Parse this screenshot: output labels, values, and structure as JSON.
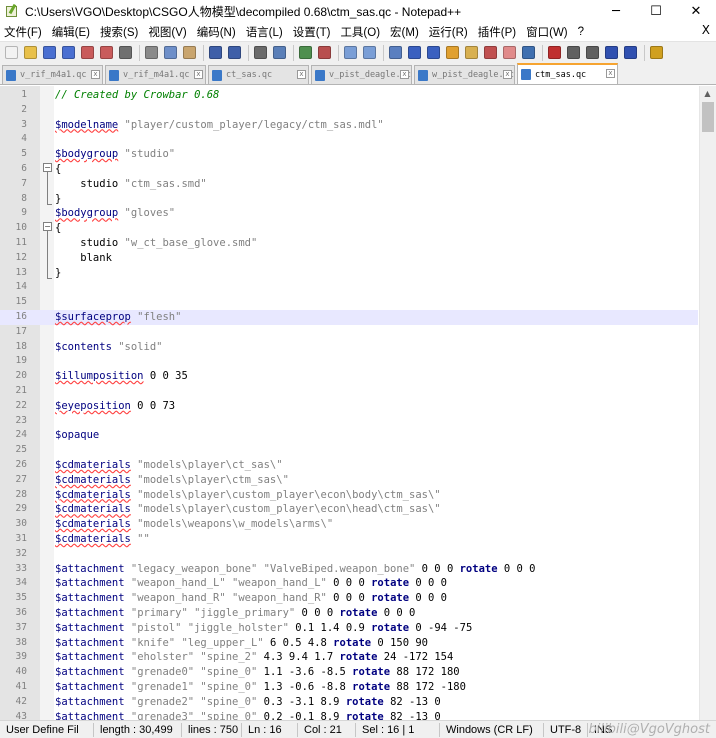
{
  "window": {
    "title": "C:\\Users\\VGO\\Desktop\\CSGO人物模型\\decompiled 0.68\\ctm_sas.qc - Notepad++",
    "minimize": "─",
    "maximize": "☐",
    "close": "✕"
  },
  "menu": {
    "items": [
      "文件(F)",
      "编辑(E)",
      "搜索(S)",
      "视图(V)",
      "编码(N)",
      "语言(L)",
      "设置(T)",
      "工具(O)",
      "宏(M)",
      "运行(R)",
      "插件(P)",
      "窗口(W)",
      "?"
    ],
    "close": "X"
  },
  "toolbar": {
    "icons": [
      {
        "name": "new-file-icon",
        "color": "#f2f2f2"
      },
      {
        "name": "open-file-icon",
        "color": "#e8c04a"
      },
      {
        "name": "save-icon",
        "color": "#4a6fd1"
      },
      {
        "name": "save-all-icon",
        "color": "#4a6fd1"
      },
      {
        "name": "close-file-icon",
        "color": "#c95b5b"
      },
      {
        "name": "close-all-icon",
        "color": "#c95b5b"
      },
      {
        "name": "print-icon",
        "color": "#707070"
      },
      {
        "sep": true
      },
      {
        "name": "cut-icon",
        "color": "#8a8a8a"
      },
      {
        "name": "copy-icon",
        "color": "#6e8fc9"
      },
      {
        "name": "paste-icon",
        "color": "#c9a56e"
      },
      {
        "sep": true
      },
      {
        "name": "undo-icon",
        "color": "#3f5fa8"
      },
      {
        "name": "redo-icon",
        "color": "#3f5fa8"
      },
      {
        "sep": true
      },
      {
        "name": "find-icon",
        "color": "#6a6a6a"
      },
      {
        "name": "replace-icon",
        "color": "#5a7fb8"
      },
      {
        "sep": true
      },
      {
        "name": "zoom-in-icon",
        "color": "#4f8f4f"
      },
      {
        "name": "zoom-out-icon",
        "color": "#b84f4f"
      },
      {
        "sep": true
      },
      {
        "name": "sync-v-icon",
        "color": "#7a9ed6"
      },
      {
        "name": "sync-h-icon",
        "color": "#7a9ed6"
      },
      {
        "sep": true
      },
      {
        "name": "word-wrap-icon",
        "color": "#5a7fc0"
      },
      {
        "name": "show-all-chars-icon",
        "color": "#3a60c0"
      },
      {
        "name": "indent-guide-icon",
        "color": "#3a60c0"
      },
      {
        "name": "lang-define-icon",
        "color": "#e0a030"
      },
      {
        "name": "doc-map-icon",
        "color": "#d8b050"
      },
      {
        "name": "function-list-icon",
        "color": "#c05050"
      },
      {
        "name": "folder-as-workspace-icon",
        "color": "#e08a8a"
      },
      {
        "name": "monitor-icon",
        "color": "#4070b0"
      },
      {
        "sep": true
      },
      {
        "name": "record-macro-icon",
        "color": "#c03030"
      },
      {
        "name": "stop-macro-icon",
        "color": "#606060"
      },
      {
        "name": "play-macro-icon",
        "color": "#606060"
      },
      {
        "name": "run-macro-multiple-icon",
        "color": "#3050b0"
      },
      {
        "name": "save-macro-icon",
        "color": "#3050b0"
      },
      {
        "sep": true
      },
      {
        "name": "spellcheck-icon",
        "color": "#d0a020"
      }
    ]
  },
  "tabs": [
    {
      "label": "v_rif_m4a1.qc",
      "active": false
    },
    {
      "label": "v_rif_m4a1.qc",
      "active": false
    },
    {
      "label": "ct_sas.qc",
      "active": false
    },
    {
      "label": "v_pist_deagle.qc",
      "active": false
    },
    {
      "label": "w_pist_deagle.qc",
      "active": false
    },
    {
      "label": "ctm_sas.qc",
      "active": true
    }
  ],
  "tab_close": "x",
  "editor": {
    "current_line": 16,
    "lines": [
      {
        "n": "1",
        "tokens": [
          {
            "t": "// Created by Crowbar 0.68",
            "c": "comment"
          }
        ]
      },
      {
        "n": "2",
        "tokens": []
      },
      {
        "n": "3",
        "tokens": [
          {
            "t": "$modelname",
            "c": "cmd-u"
          },
          {
            "t": " \"player/custom_player/legacy/ctm_sas.mdl\"",
            "c": "str"
          }
        ]
      },
      {
        "n": "4",
        "tokens": []
      },
      {
        "n": "5",
        "tokens": [
          {
            "t": "$bodygroup",
            "c": "cmd-u"
          },
          {
            "t": " \"studio\"",
            "c": "str"
          }
        ]
      },
      {
        "n": "6",
        "tokens": [
          {
            "t": "{",
            "c": "brace"
          }
        ]
      },
      {
        "n": "7",
        "tokens": [
          {
            "t": "    studio ",
            "c": "plain"
          },
          {
            "t": "\"ctm_sas.smd\"",
            "c": "str"
          }
        ]
      },
      {
        "n": "8",
        "tokens": [
          {
            "t": "}",
            "c": "brace"
          }
        ]
      },
      {
        "n": "9",
        "tokens": [
          {
            "t": "$bodygroup",
            "c": "cmd-u"
          },
          {
            "t": " \"gloves\"",
            "c": "str"
          }
        ]
      },
      {
        "n": "10",
        "tokens": [
          {
            "t": "{",
            "c": "brace"
          }
        ]
      },
      {
        "n": "11",
        "tokens": [
          {
            "t": "    studio ",
            "c": "plain"
          },
          {
            "t": "\"w_ct_base_glove.smd\"",
            "c": "str"
          }
        ]
      },
      {
        "n": "12",
        "tokens": [
          {
            "t": "    blank",
            "c": "plain"
          }
        ]
      },
      {
        "n": "13",
        "tokens": [
          {
            "t": "}",
            "c": "brace"
          }
        ]
      },
      {
        "n": "14",
        "tokens": []
      },
      {
        "n": "15",
        "tokens": []
      },
      {
        "n": "16",
        "tokens": [
          {
            "t": "$surfaceprop",
            "c": "cmd-u"
          },
          {
            "t": " \"flesh\"",
            "c": "str"
          }
        ]
      },
      {
        "n": "17",
        "tokens": []
      },
      {
        "n": "18",
        "tokens": [
          {
            "t": "$contents",
            "c": "cmd"
          },
          {
            "t": " \"solid\"",
            "c": "str"
          }
        ]
      },
      {
        "n": "19",
        "tokens": []
      },
      {
        "n": "20",
        "tokens": [
          {
            "t": "$illumposition",
            "c": "cmd-u"
          },
          {
            "t": " 0 0 35",
            "c": "num"
          }
        ]
      },
      {
        "n": "21",
        "tokens": []
      },
      {
        "n": "22",
        "tokens": [
          {
            "t": "$eyeposition",
            "c": "cmd-u"
          },
          {
            "t": " 0 0 73",
            "c": "num"
          }
        ]
      },
      {
        "n": "23",
        "tokens": []
      },
      {
        "n": "24",
        "tokens": [
          {
            "t": "$opaque",
            "c": "cmd"
          }
        ]
      },
      {
        "n": "25",
        "tokens": []
      },
      {
        "n": "26",
        "tokens": [
          {
            "t": "$cdmaterials",
            "c": "cmd-u"
          },
          {
            "t": " \"models\\player\\ct_sas\\\"",
            "c": "str"
          }
        ]
      },
      {
        "n": "27",
        "tokens": [
          {
            "t": "$cdmaterials",
            "c": "cmd-u"
          },
          {
            "t": " \"models\\player\\ctm_sas\\\"",
            "c": "str"
          }
        ]
      },
      {
        "n": "28",
        "tokens": [
          {
            "t": "$cdmaterials",
            "c": "cmd-u"
          },
          {
            "t": " \"models\\player\\custom_player\\econ\\body\\ctm_sas\\\"",
            "c": "str"
          }
        ]
      },
      {
        "n": "29",
        "tokens": [
          {
            "t": "$cdmaterials",
            "c": "cmd-u"
          },
          {
            "t": " \"models\\player\\custom_player\\econ\\head\\ctm_sas\\\"",
            "c": "str"
          }
        ]
      },
      {
        "n": "30",
        "tokens": [
          {
            "t": "$cdmaterials",
            "c": "cmd-u"
          },
          {
            "t": " \"models\\weapons\\w_models\\arms\\\"",
            "c": "str"
          }
        ]
      },
      {
        "n": "31",
        "tokens": [
          {
            "t": "$cdmaterials",
            "c": "cmd-u"
          },
          {
            "t": " \"\"",
            "c": "str"
          }
        ]
      },
      {
        "n": "32",
        "tokens": []
      },
      {
        "n": "33",
        "tokens": [
          {
            "t": "$attachment",
            "c": "cmd"
          },
          {
            "t": " \"legacy_weapon_bone\" \"ValveBiped.weapon_bone\"",
            "c": "str"
          },
          {
            "t": " 0 0 0 ",
            "c": "num"
          },
          {
            "t": "rotate",
            "c": "kw"
          },
          {
            "t": " 0 0 0",
            "c": "num"
          }
        ]
      },
      {
        "n": "34",
        "tokens": [
          {
            "t": "$attachment",
            "c": "cmd"
          },
          {
            "t": " \"weapon_hand_L\" \"weapon_hand_L\"",
            "c": "str"
          },
          {
            "t": " 0 0 0 ",
            "c": "num"
          },
          {
            "t": "rotate",
            "c": "kw"
          },
          {
            "t": " 0 0 0",
            "c": "num"
          }
        ]
      },
      {
        "n": "35",
        "tokens": [
          {
            "t": "$attachment",
            "c": "cmd"
          },
          {
            "t": " \"weapon_hand_R\" \"weapon_hand_R\"",
            "c": "str"
          },
          {
            "t": " 0 0 0 ",
            "c": "num"
          },
          {
            "t": "rotate",
            "c": "kw"
          },
          {
            "t": " 0 0 0",
            "c": "num"
          }
        ]
      },
      {
        "n": "36",
        "tokens": [
          {
            "t": "$attachment",
            "c": "cmd"
          },
          {
            "t": " \"primary\" \"jiggle_primary\"",
            "c": "str"
          },
          {
            "t": " 0 0 0 ",
            "c": "num"
          },
          {
            "t": "rotate",
            "c": "kw"
          },
          {
            "t": " 0 0 0",
            "c": "num"
          }
        ]
      },
      {
        "n": "37",
        "tokens": [
          {
            "t": "$attachment",
            "c": "cmd"
          },
          {
            "t": " \"pistol\" \"jiggle_holster\"",
            "c": "str"
          },
          {
            "t": " 0.1 1.4 0.9 ",
            "c": "num"
          },
          {
            "t": "rotate",
            "c": "kw"
          },
          {
            "t": " 0 -94 -75",
            "c": "num"
          }
        ]
      },
      {
        "n": "38",
        "tokens": [
          {
            "t": "$attachment",
            "c": "cmd"
          },
          {
            "t": " \"knife\" \"leg_upper_L\"",
            "c": "str"
          },
          {
            "t": " 6 0.5 4.8 ",
            "c": "num"
          },
          {
            "t": "rotate",
            "c": "kw"
          },
          {
            "t": " 0 150 90",
            "c": "num"
          }
        ]
      },
      {
        "n": "39",
        "tokens": [
          {
            "t": "$attachment",
            "c": "cmd"
          },
          {
            "t": " \"eholster\" \"spine_2\"",
            "c": "str"
          },
          {
            "t": " 4.3 9.4 1.7 ",
            "c": "num"
          },
          {
            "t": "rotate",
            "c": "kw"
          },
          {
            "t": " 24 -172 154",
            "c": "num"
          }
        ]
      },
      {
        "n": "40",
        "tokens": [
          {
            "t": "$attachment",
            "c": "cmd"
          },
          {
            "t": " \"grenade0\" \"spine_0\"",
            "c": "str"
          },
          {
            "t": " 1.1 -3.6 -8.5 ",
            "c": "num"
          },
          {
            "t": "rotate",
            "c": "kw"
          },
          {
            "t": " 88 172 180",
            "c": "num"
          }
        ]
      },
      {
        "n": "41",
        "tokens": [
          {
            "t": "$attachment",
            "c": "cmd"
          },
          {
            "t": " \"grenade1\" \"spine_0\"",
            "c": "str"
          },
          {
            "t": " 1.3 -0.6 -8.8 ",
            "c": "num"
          },
          {
            "t": "rotate",
            "c": "kw"
          },
          {
            "t": " 88 172 -180",
            "c": "num"
          }
        ]
      },
      {
        "n": "42",
        "tokens": [
          {
            "t": "$attachment",
            "c": "cmd"
          },
          {
            "t": " \"grenade2\" \"spine_0\"",
            "c": "str"
          },
          {
            "t": " 0.3 -3.1 8.9 ",
            "c": "num"
          },
          {
            "t": "rotate",
            "c": "kw"
          },
          {
            "t": " 82 -13 0",
            "c": "num"
          }
        ]
      },
      {
        "n": "43",
        "tokens": [
          {
            "t": "$attachment",
            "c": "cmd"
          },
          {
            "t": " \"grenade3\" \"spine_0\"",
            "c": "str"
          },
          {
            "t": " 0.2 -0.1 8.9 ",
            "c": "num"
          },
          {
            "t": "rotate",
            "c": "kw"
          },
          {
            "t": " 82 -13 0",
            "c": "num"
          }
        ]
      }
    ]
  },
  "status": {
    "file_type": "User Define Fil",
    "length": "length : 30,499",
    "lines": "lines : 750",
    "ln": "Ln : 16",
    "col": "Col : 21",
    "sel": "Sel : 16 | 1",
    "eol": "Windows (CR LF)",
    "encoding": "UTF-8",
    "ins": "INS",
    "watermark": "bilibili@VgoVghost"
  }
}
